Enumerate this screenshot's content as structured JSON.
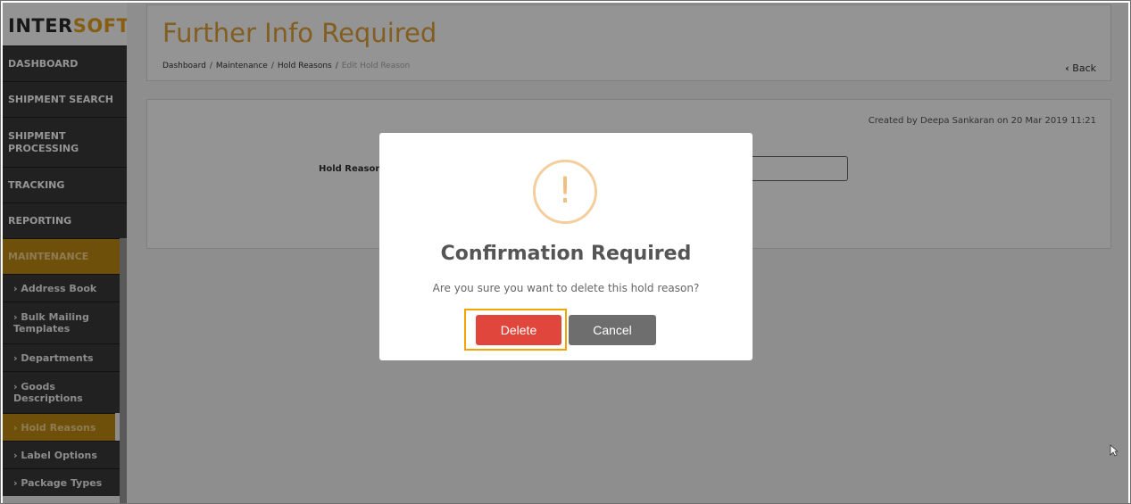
{
  "logo": {
    "part1": "INTER",
    "part2": "SOFT"
  },
  "sidebar": {
    "items": [
      {
        "label": "DASHBOARD"
      },
      {
        "label": "SHIPMENT SEARCH"
      },
      {
        "label": "SHIPMENT PROCESSING"
      },
      {
        "label": "TRACKING"
      },
      {
        "label": "REPORTING"
      },
      {
        "label": "MAINTENANCE"
      }
    ],
    "subitems": [
      {
        "label": "› Address Book"
      },
      {
        "label": "› Bulk Mailing Templates"
      },
      {
        "label": "› Departments"
      },
      {
        "label": "› Goods Descriptions"
      },
      {
        "label": "› Hold Reasons"
      },
      {
        "label": "› Label Options"
      },
      {
        "label": "› Package Types"
      }
    ]
  },
  "header": {
    "title": "Further Info Required",
    "breadcrumb": [
      "Dashboard",
      "Maintenance",
      "Hold Reasons",
      "Edit Hold Reason"
    ],
    "separator": "/",
    "back_label": "Back"
  },
  "content": {
    "created": "Created by Deepa Sankaran on 20 Mar 2019 11:21",
    "field_label": "Hold Reason",
    "field_value": ""
  },
  "modal": {
    "icon": "!",
    "title": "Confirmation Required",
    "message": "Are you sure you want to delete this hold reason?",
    "delete_label": "Delete",
    "cancel_label": "Cancel"
  },
  "colors": {
    "accent": "#e2a23a",
    "delete": "#e0463b",
    "cancel": "#6e6e6e",
    "sidebar": "#393939",
    "sidebar_active": "#c08a14"
  }
}
